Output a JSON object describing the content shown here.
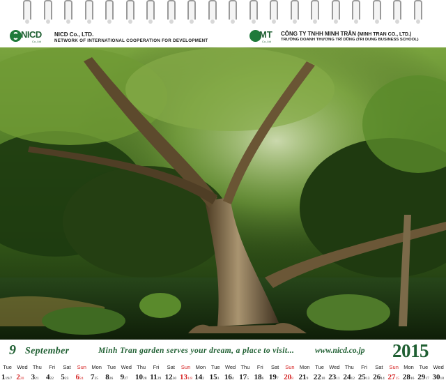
{
  "header": {
    "left_logo_word": "NICD",
    "left_logo_sub": "Co.,Ltd",
    "left_org_name": "NICD Co., LTD.",
    "left_org_full": "NETWORK OF INTERNATIONAL COOPERATION FOR DEVELOPMENT",
    "right_logo_word": "MT",
    "right_logo_sub": "Co.,Ltd",
    "right_org_name": "CÔNG TY TNHH MINH TRÂN",
    "right_org_paren": "(MINH TRAN CO., LTD.)",
    "right_org_school": "TRƯỜNG DOANH THƯƠNG TRÍ DŨNG (TRI DUNG BUSINESS SCHOOL)"
  },
  "band": {
    "month_number": "9",
    "month_name": "September",
    "slogan": "Minh Tran garden serves your dream, a place to visit...",
    "website": "www.nicd.co.jp",
    "year": "2015"
  },
  "calendar": [
    {
      "wd": "Tue",
      "d": "1",
      "l": "19/7",
      "sun": false
    },
    {
      "wd": "Wed",
      "d": "2",
      "l": "20",
      "sun": true
    },
    {
      "wd": "Thu",
      "d": "3",
      "l": "21",
      "sun": false
    },
    {
      "wd": "Fri",
      "d": "4",
      "l": "22",
      "sun": false
    },
    {
      "wd": "Sat",
      "d": "5",
      "l": "23",
      "sun": false
    },
    {
      "wd": "Sun",
      "d": "6",
      "l": "24",
      "sun": true
    },
    {
      "wd": "Mon",
      "d": "7",
      "l": "25",
      "sun": false
    },
    {
      "wd": "Tue",
      "d": "8",
      "l": "26",
      "sun": false
    },
    {
      "wd": "Wed",
      "d": "9",
      "l": "27",
      "sun": false
    },
    {
      "wd": "Thu",
      "d": "10",
      "l": "28",
      "sun": false
    },
    {
      "wd": "Fri",
      "d": "11",
      "l": "29",
      "sun": false
    },
    {
      "wd": "Sat",
      "d": "12",
      "l": "30",
      "sun": false
    },
    {
      "wd": "Sun",
      "d": "13",
      "l": "1/8",
      "sun": true
    },
    {
      "wd": "Mon",
      "d": "14",
      "l": "2",
      "sun": false
    },
    {
      "wd": "Tue",
      "d": "15",
      "l": "3",
      "sun": false
    },
    {
      "wd": "Wed",
      "d": "16",
      "l": "4",
      "sun": false
    },
    {
      "wd": "Thu",
      "d": "17",
      "l": "5",
      "sun": false
    },
    {
      "wd": "Fri",
      "d": "18",
      "l": "6",
      "sun": false
    },
    {
      "wd": "Sat",
      "d": "19",
      "l": "7",
      "sun": false
    },
    {
      "wd": "Sun",
      "d": "20",
      "l": "8",
      "sun": true
    },
    {
      "wd": "Mon",
      "d": "21",
      "l": "9",
      "sun": false
    },
    {
      "wd": "Tue",
      "d": "22",
      "l": "10",
      "sun": false
    },
    {
      "wd": "Wed",
      "d": "23",
      "l": "11",
      "sun": false
    },
    {
      "wd": "Thu",
      "d": "24",
      "l": "12",
      "sun": false
    },
    {
      "wd": "Fri",
      "d": "25",
      "l": "13",
      "sun": false
    },
    {
      "wd": "Sat",
      "d": "26",
      "l": "14",
      "sun": false
    },
    {
      "wd": "Sun",
      "d": "27",
      "l": "15",
      "sun": true
    },
    {
      "wd": "Mon",
      "d": "28",
      "l": "16",
      "sun": false
    },
    {
      "wd": "Tue",
      "d": "29",
      "l": "17",
      "sun": false
    },
    {
      "wd": "Wed",
      "d": "30",
      "l": "18",
      "sun": false
    }
  ],
  "colors": {
    "brand_green": "#1f5f32",
    "sunday_red": "#d42020"
  }
}
